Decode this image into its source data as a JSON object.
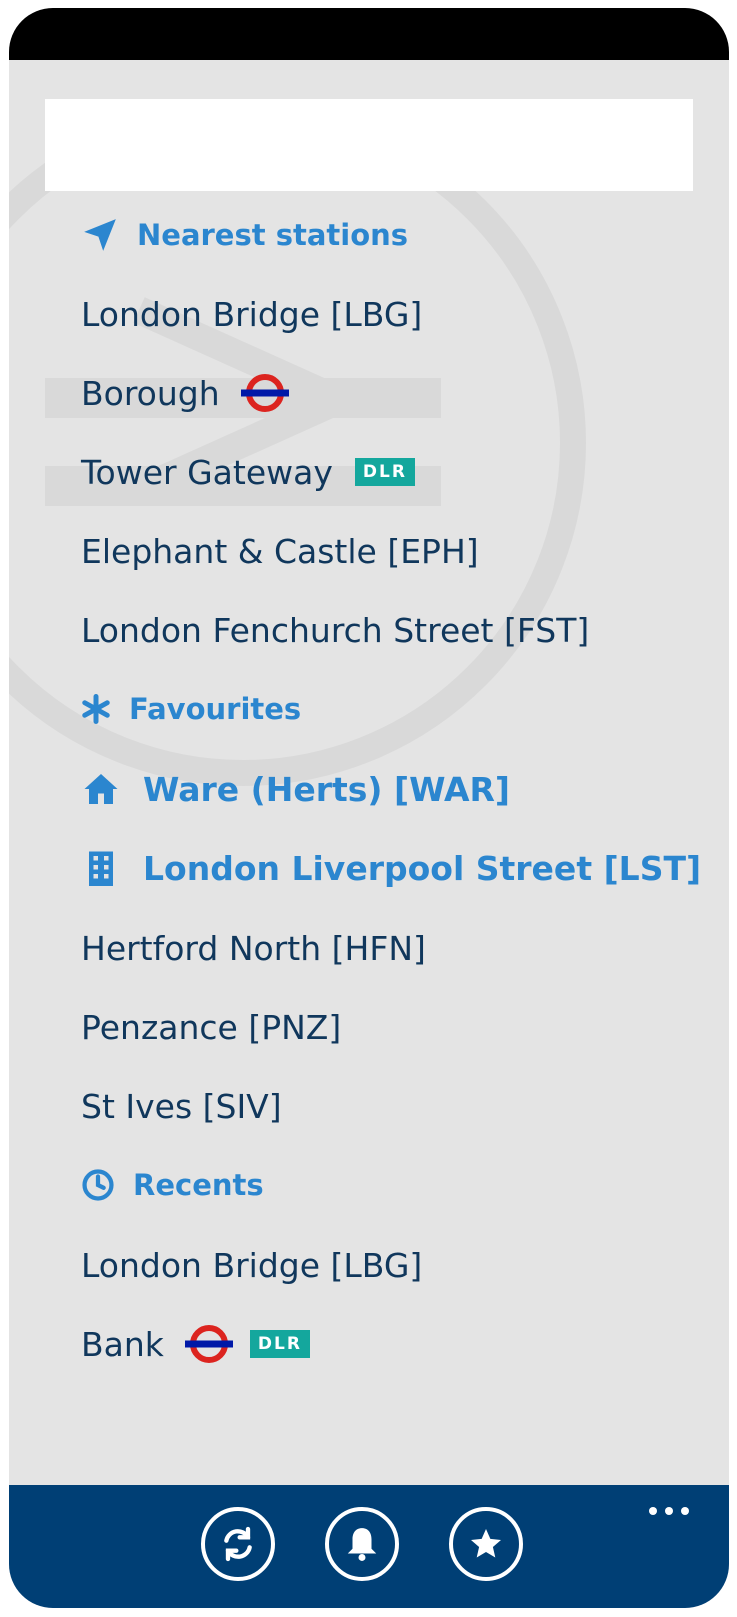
{
  "search": {
    "placeholder": "",
    "value": ""
  },
  "nearest": {
    "header": "Nearest stations",
    "items": [
      {
        "label": "London Bridge [LBG]",
        "underground": false,
        "dlr": false
      },
      {
        "label": "Borough",
        "underground": true,
        "dlr": false
      },
      {
        "label": "Tower Gateway",
        "underground": false,
        "dlr": true
      },
      {
        "label": "Elephant & Castle [EPH]",
        "underground": false,
        "dlr": false
      },
      {
        "label": "London Fenchurch Street [FST]",
        "underground": false,
        "dlr": false
      }
    ]
  },
  "favourites": {
    "header": "Favourites",
    "home": "Ware (Herts) [WAR]",
    "work": "London Liverpool Street [LST]",
    "items": [
      "Hertford North [HFN]",
      "Penzance [PNZ]",
      "St Ives [SIV]"
    ]
  },
  "recents": {
    "header": "Recents",
    "items": [
      {
        "label": "London Bridge [LBG]",
        "underground": false,
        "dlr": false
      },
      {
        "label": "Bank",
        "underground": true,
        "dlr": true
      }
    ]
  },
  "badges": {
    "dlr": "DLR"
  },
  "icons": {
    "nearest": "location-arrow-icon",
    "favourites": "asterisk-icon",
    "recents": "clock-icon",
    "home": "home-icon",
    "work": "building-icon",
    "refresh": "refresh-icon",
    "alerts": "bell-icon",
    "favourite": "star-icon",
    "more": "ellipsis-icon"
  },
  "colors": {
    "accent": "#2b86cf",
    "text": "#10375c",
    "background": "#e4e4e4",
    "app_bar": "#003f75",
    "dlr": "#14a79d",
    "underground_red": "#dc241f",
    "underground_blue": "#0019a8"
  }
}
